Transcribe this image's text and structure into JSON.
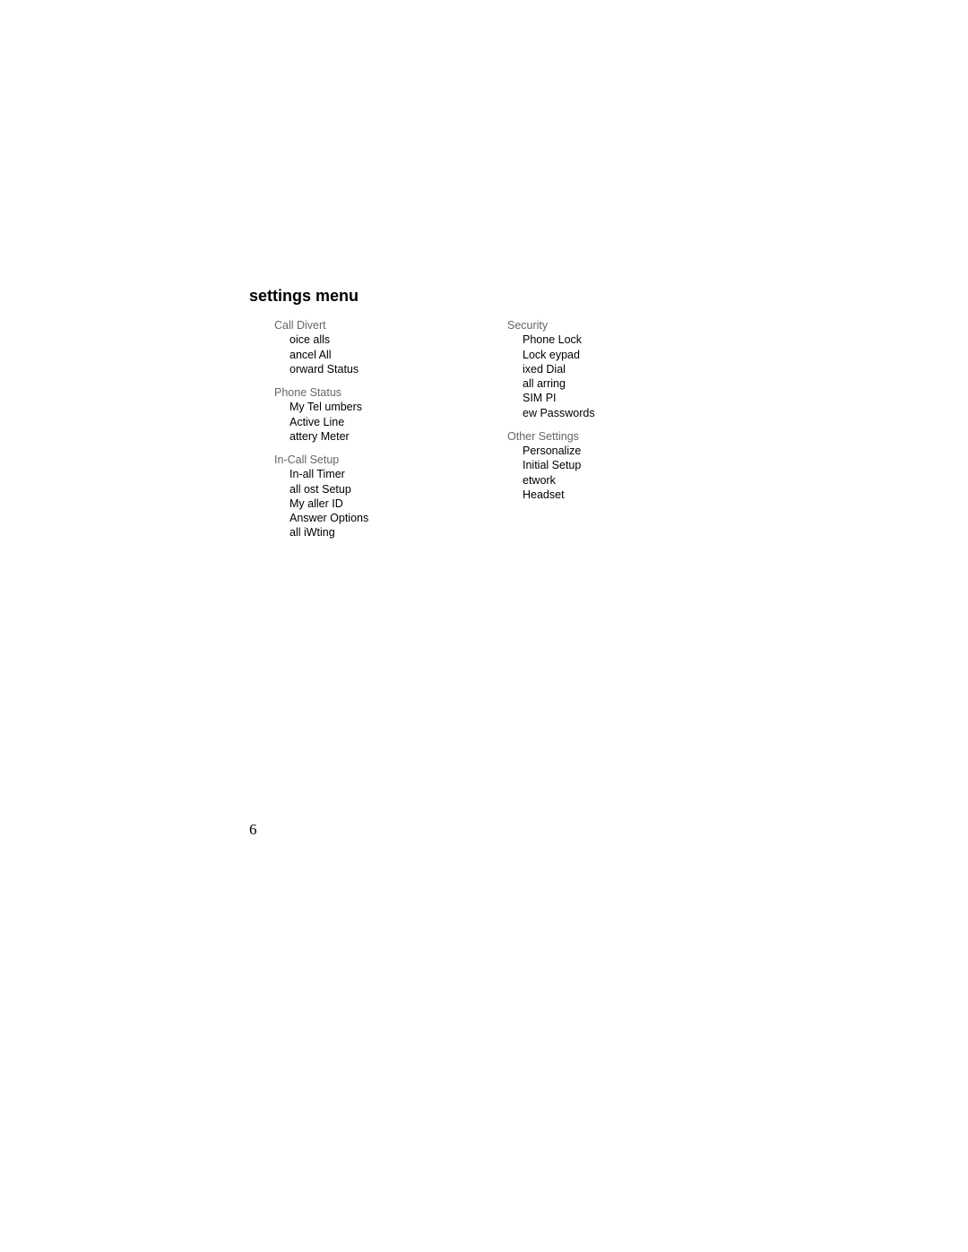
{
  "title": "settings menu",
  "page_number": "6",
  "left_column": [
    {
      "header": "Call Divert",
      "items": [
        "oice alls",
        "ancel All",
        "orward Status"
      ]
    },
    {
      "header": "Phone Status",
      "items": [
        "My Tel umbers",
        "Active Line",
        "attery Meter"
      ]
    },
    {
      "header": "In-Call Setup",
      "items": [
        "In-all Timer",
        "all ost Setup",
        "My aller ID",
        "Answer Options",
        "all iWting"
      ]
    }
  ],
  "right_column": [
    {
      "header": "Security",
      "items": [
        "Phone Lock",
        "Lock eypad",
        "ixed Dial",
        "all arring",
        "SIM PI",
        "ew Passwords"
      ]
    },
    {
      "header": "Other Settings",
      "items": [
        "Personalize",
        "Initial Setup",
        "etwork",
        "Headset"
      ]
    }
  ]
}
